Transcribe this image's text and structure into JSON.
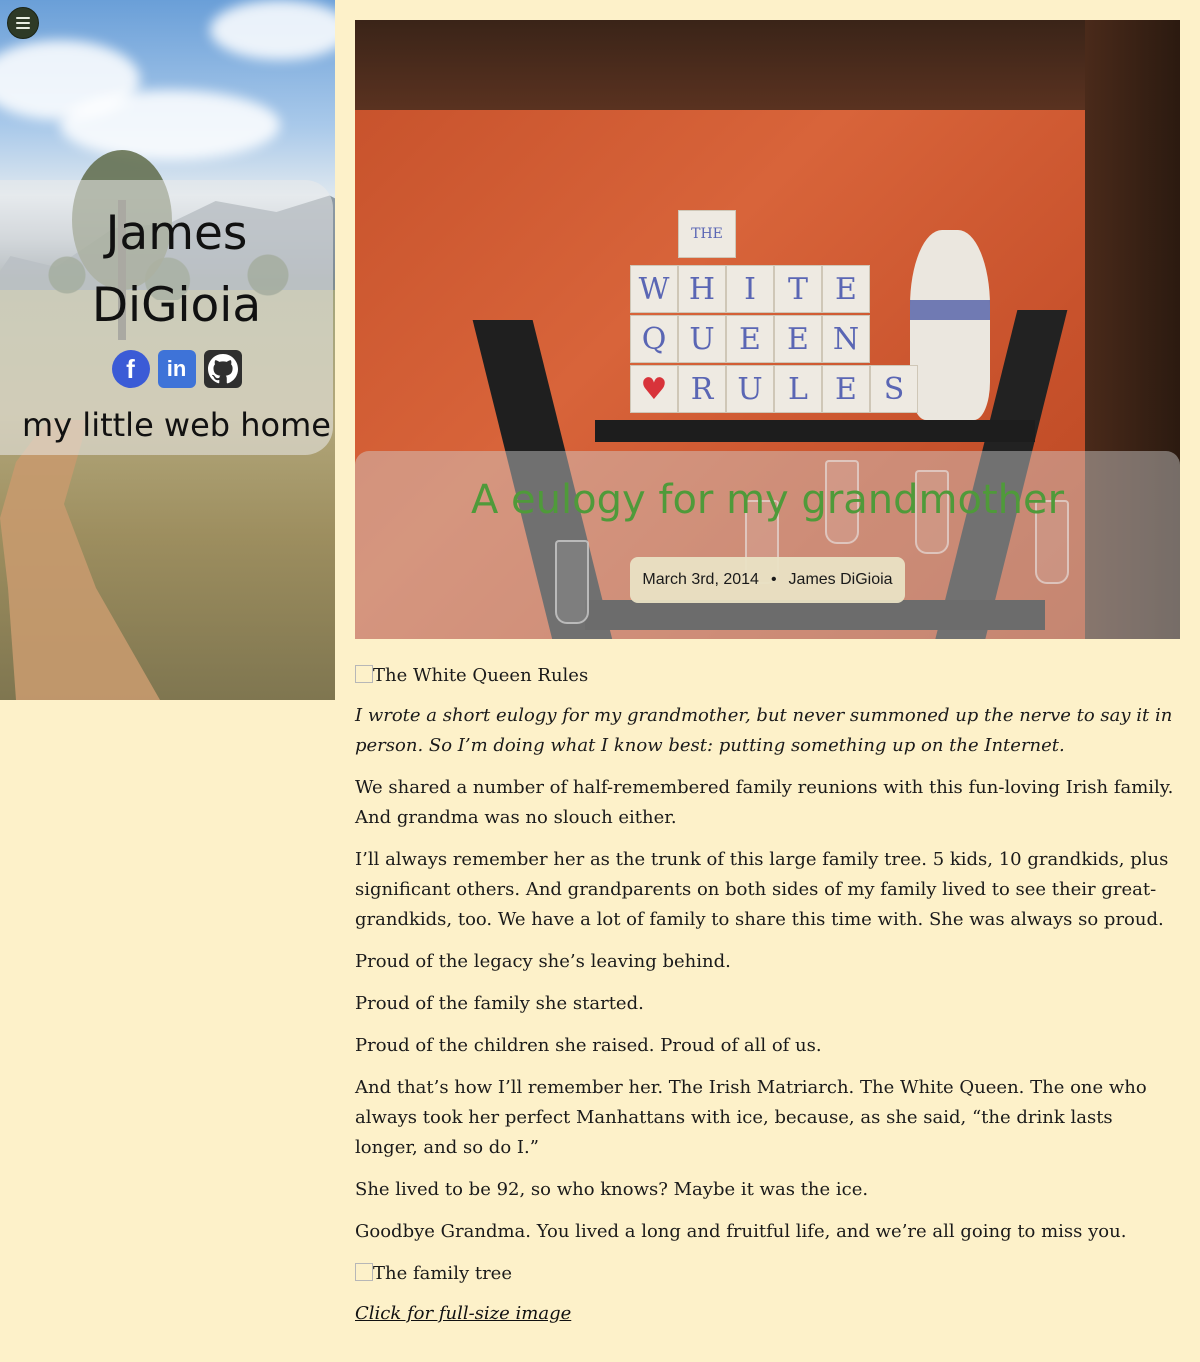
{
  "site": {
    "name": "James DiGioia",
    "tagline": "my little web home",
    "social": [
      {
        "icon": "facebook-icon",
        "glyph": "f",
        "color": "#3b5bd6"
      },
      {
        "icon": "linkedin-icon",
        "glyph": "in",
        "color": "#3e73d8"
      },
      {
        "icon": "github-icon",
        "color": "#2f2f2f"
      }
    ]
  },
  "menu": {
    "icon": "hamburger-menu-icon"
  },
  "post": {
    "title": "A eulogy for my grandmother",
    "date": "March 3rd, 2014",
    "separator": "•",
    "author": "James DiGioia",
    "hero_image_blocks": [
      "THE",
      "W",
      "H",
      "I",
      "T",
      "E",
      "Q",
      "U",
      "E",
      "E",
      "N",
      "R",
      "U",
      "L",
      "E",
      "S"
    ],
    "image1_alt": "The White Queen Rules",
    "intro": "I wrote a short eulogy for my grandmother, but never summoned up the nerve to say it in person. So I’m doing what I know best: putting something up on the Internet.",
    "paragraphs": [
      "We shared a number of half-remembered family reunions with this fun-loving Irish family. And grandma was no slouch either.",
      "I’ll always remember her as the trunk of this large family tree. 5 kids, 10 grandkids, plus significant others. And grandparents on both sides of my family lived to see their great-grandkids, too. We have a lot of family to share this time with. She was always so proud.",
      "Proud of the legacy she’s leaving behind.",
      "Proud of the family she started.",
      "Proud of the children she raised. Proud of all of us.",
      "And that’s how I’ll remember her. The Irish Matriarch. The White Queen. The one who always took her perfect Manhattans with ice, because, as she said, “the drink lasts longer, and so do I.”",
      "She lived to be 92, so who knows? Maybe it was the ice.",
      "Goodbye Grandma. You lived a long and fruitful life, and we’re all going to miss you."
    ],
    "image2_alt": "The family tree",
    "full_size_link": "Click for full-size image"
  },
  "colors": {
    "background": "#fdf1c9",
    "title_green": "#4f9a3a"
  }
}
